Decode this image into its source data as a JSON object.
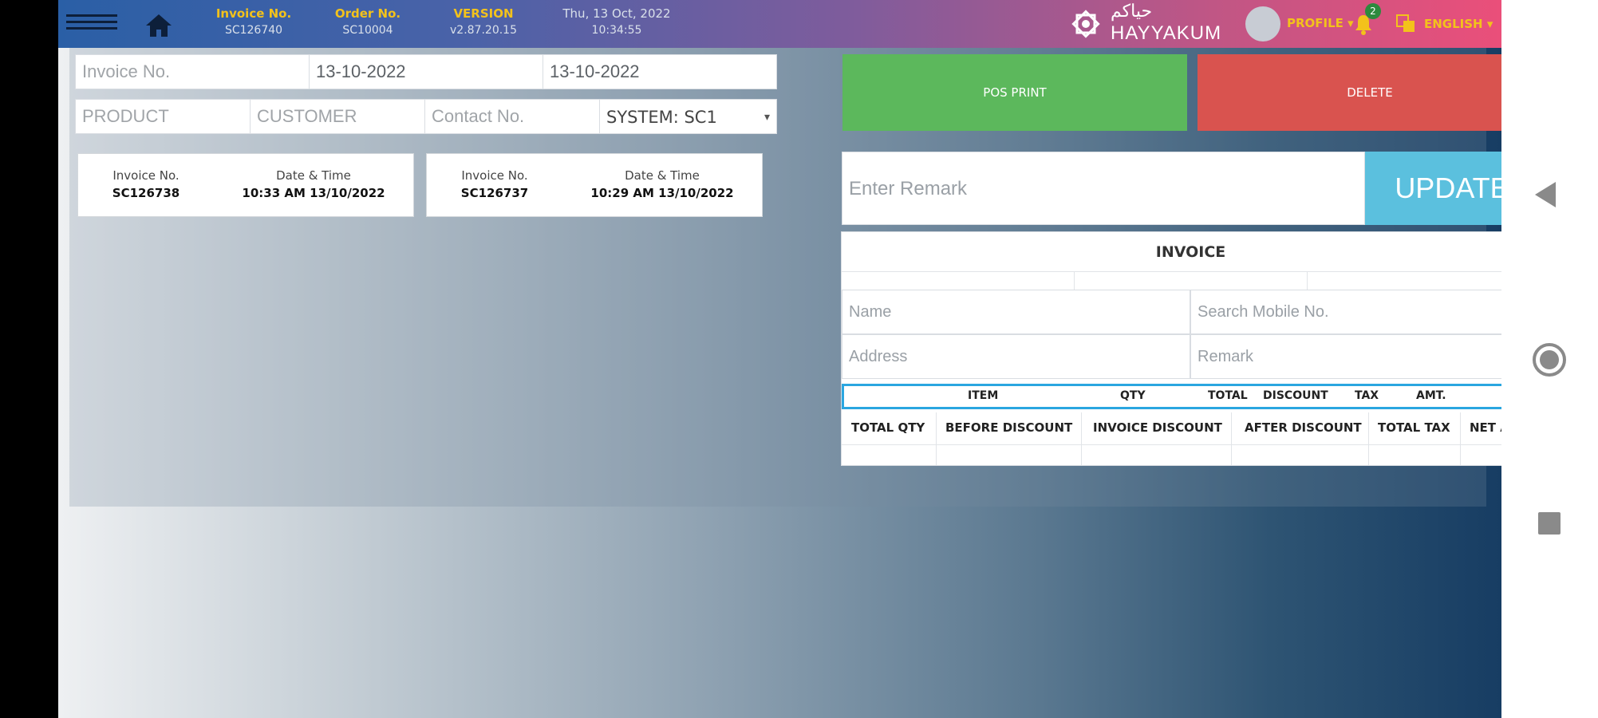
{
  "header": {
    "invoice_no_label": "Invoice No.",
    "invoice_no_value": "SC126740",
    "order_no_label": "Order No.",
    "order_no_value": "SC10004",
    "version_label": "VERSION",
    "version_value": "v2.87.20.15",
    "date_label": "Thu, 13 Oct, 2022",
    "time_value": "10:34:55",
    "logo_arabic": "حياكم",
    "logo_text": "HAYYAKUM",
    "profile_label": "PROFILE ▾",
    "notification_count": "2",
    "language_label": "ENGLISH ▾"
  },
  "filters": {
    "invoice_no_placeholder": "Invoice No.",
    "date_from": "13-10-2022",
    "date_to": "13-10-2022",
    "product_placeholder": "PRODUCT",
    "customer_placeholder": "CUSTOMER",
    "contact_placeholder": "Contact No.",
    "system_selected": "SYSTEM: SC1"
  },
  "actions": {
    "pos_print_label": "POS PRINT",
    "delete_label": "DELETE"
  },
  "invoice_cards": [
    {
      "invoice_label": "Invoice No.",
      "invoice_value": "SC126738",
      "datetime_label": "Date & Time",
      "datetime_value": "10:33 AM 13/10/2022"
    },
    {
      "invoice_label": "Invoice No.",
      "invoice_value": "SC126737",
      "datetime_label": "Date & Time",
      "datetime_value": "10:29 AM 13/10/2022"
    }
  ],
  "remark": {
    "placeholder": "Enter Remark",
    "update_label": "UPDATE"
  },
  "invoice": {
    "title": "INVOICE",
    "name_placeholder": "Name",
    "mobile_placeholder": "Search Mobile No.",
    "address_placeholder": "Address",
    "remark_placeholder": "Remark",
    "item_columns": [
      "ITEM",
      "QTY",
      "TOTAL",
      "DISCOUNT",
      "TAX",
      "AMT."
    ],
    "total_columns": [
      "TOTAL QTY",
      "BEFORE DISCOUNT",
      "INVOICE DISCOUNT",
      "AFTER DISCOUNT",
      "TOTAL TAX",
      "NET AMT."
    ]
  },
  "colors": {
    "accent_yellow": "#f3c21b",
    "print_green": "#5cb85c",
    "delete_red": "#d9534f",
    "update_blue": "#5bc0de"
  }
}
